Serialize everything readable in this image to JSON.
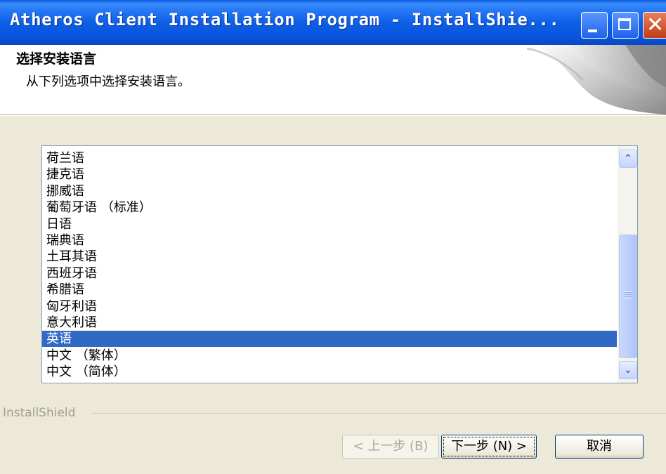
{
  "window": {
    "title": "Atheros Client Installation Program - InstallShie...",
    "controls": {
      "minimize": "minimize-icon",
      "maximize": "maximize-icon",
      "close": "close-icon"
    }
  },
  "header": {
    "title": "选择安装语言",
    "subtitle": "从下列选项中选择安装语言。"
  },
  "language_list": {
    "items": [
      "荷兰语",
      "捷克语",
      "挪威语",
      "葡萄牙语 （标准）",
      "日语",
      "瑞典语",
      "土耳其语",
      "西班牙语",
      "希腊语",
      "匈牙利语",
      "意大利语",
      "英语",
      "中文 （繁体）",
      "中文 （简体）"
    ],
    "selected": "英语"
  },
  "footer": {
    "brand": "InstallShield",
    "buttons": {
      "back": "< 上一步 (B)",
      "next": "下一步 (N) >",
      "cancel": "取消"
    }
  },
  "colors": {
    "title_bar": "#0a55dd",
    "selection": "#316ac5",
    "dialog_face": "#ece9d8"
  }
}
